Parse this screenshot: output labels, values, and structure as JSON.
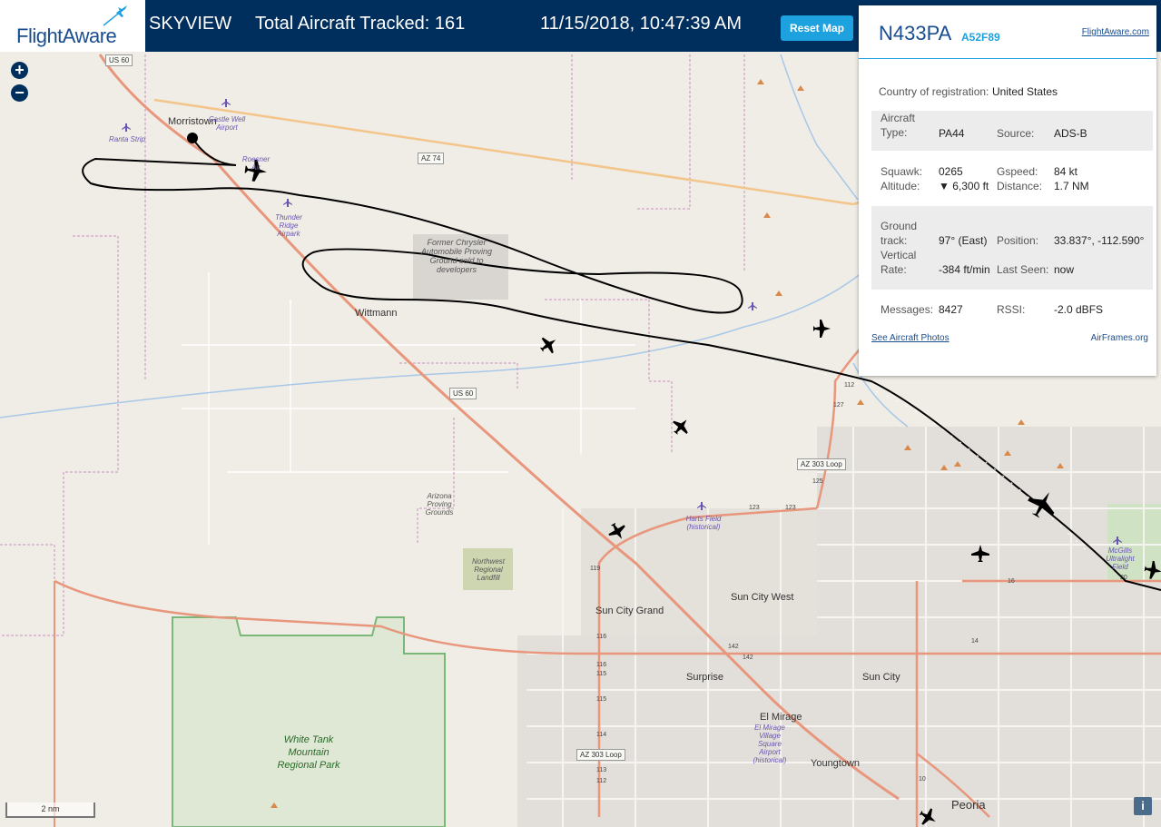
{
  "header": {
    "logo_text": "FlightAware",
    "app_name": "SKYVIEW",
    "tracked": "Total Aircraft Tracked: 161",
    "datetime": "11/15/2018, 10:47:39 AM",
    "reset_label": "Reset Map"
  },
  "map": {
    "zoom_in": "+",
    "zoom_out": "−",
    "scale_label": "2 nm",
    "info_label": "i",
    "towns": [
      "Morristown",
      "Wittmann",
      "Sun City Grand",
      "Sun City West",
      "Surprise",
      "Sun City",
      "El Mirage",
      "Youngtown",
      "Peoria"
    ],
    "parks": [
      "White Tank Mountain Regional Park"
    ],
    "areas": [
      "Former Chrysler Automobile Proving Ground sold to developers",
      "Arizona Proving Grounds",
      "Northwest Regional Landfill"
    ],
    "airports": [
      "Castle Well Airport",
      "Ranta Strip",
      "Roesner Air",
      "Thunder Ridge Airpark",
      "Harts Field (historical)",
      "El Mirage Village Square Airport (historical)",
      "McGills Ultralight Field"
    ],
    "shields": [
      "US 60",
      "AZ 74",
      "US 60",
      "AZ 303 Loop",
      "AZ 303 Loop"
    ],
    "road_numbers": [
      "112",
      "127",
      "125",
      "123",
      "123",
      "119",
      "116",
      "116",
      "115",
      "115",
      "114",
      "113",
      "112",
      "142",
      "142",
      "14",
      "10",
      "16",
      "20"
    ]
  },
  "panel": {
    "registration": "N433PA",
    "hex": "A52F89",
    "fa_link": "FlightAware.com",
    "country_label": "Country of registration:",
    "country": "United States",
    "type_label": "Aircraft Type:",
    "type": "PA44",
    "source_label": "Source:",
    "source": "ADS-B",
    "squawk_label": "Squawk:",
    "squawk": "0265",
    "gspeed_label": "Gspeed:",
    "gspeed": "84 kt",
    "altitude_label": "Altitude:",
    "altitude": "▼ 6,300 ft",
    "distance_label": "Distance:",
    "distance": "1.7 NM",
    "track_label": "Ground track:",
    "track": "97° (East)",
    "position_label": "Position:",
    "position": "33.837°, -112.590°",
    "vrate_label": "Vertical Rate:",
    "vrate": "-384 ft/min",
    "lastseen_label": "Last Seen:",
    "lastseen": "now",
    "messages_label": "Messages:",
    "messages": "8427",
    "rssi_label": "RSSI:",
    "rssi": "-2.0 dBFS",
    "photos_link": "See Aircraft Photos",
    "airframes_link": "AirFrames.org"
  },
  "colors": {
    "header_bg": "#002f5d",
    "accent": "#1da1df",
    "highway": "#e8967c",
    "boundary": "#c78fc4",
    "water": "#a8c8e8",
    "track": "#000000"
  }
}
